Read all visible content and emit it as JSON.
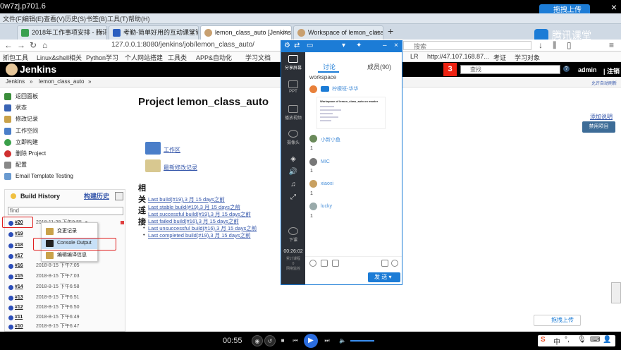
{
  "video": {
    "title": "0w7zj.p701.6",
    "share_label": "拖拽上传",
    "share_bottom_label": "拖拽上传",
    "time": "00:55",
    "brand": "腾讯课堂"
  },
  "browser": {
    "menu": [
      "文件(F)",
      "编辑(E)",
      "查看(V)",
      "历史(S)",
      "书签(B)",
      "工具(T)",
      "帮助(H)"
    ],
    "tabs": [
      {
        "label": "2018年工作事项安排 - 腾讯文档",
        "active": false
      },
      {
        "label": "考勤-简单好用的互动课堂管理",
        "active": false
      },
      {
        "label": "lemon_class_auto [Jenkins]",
        "active": true
      },
      {
        "label": "Workspace of lemon_class_auto",
        "active": false
      }
    ],
    "url": "127.0.0.1:8080/jenkins/job/lemon_class_auto/",
    "search_placeholder": "搜索",
    "bookmarks": [
      "抓包工具",
      "Linux&shell相关",
      "Python学习",
      "个人网站搭建",
      "工具类",
      "APP&自动化",
      "学习文档",
      "LR",
      "http://47.107.168.87...",
      "考证",
      "学习对象"
    ]
  },
  "jenkins": {
    "brand": "Jenkins",
    "badge": "3",
    "search_placeholder": "查找",
    "user": "admin",
    "logout": "| 注销",
    "crumbs": [
      "Jenkins",
      "»",
      "lemon_class_auto",
      "»"
    ],
    "auto_refresh": "允许自动刷新",
    "sidebar": [
      {
        "label": "返回面板",
        "color": "#3a8d3a"
      },
      {
        "label": "状态",
        "color": "#3a64b4"
      },
      {
        "label": "修改记录",
        "color": "#c9a24a"
      },
      {
        "label": "工作空间",
        "color": "#4a7ec9"
      },
      {
        "label": "立即构建",
        "color": "#3aa04a"
      },
      {
        "label": "删除 Project",
        "color": "#d03030"
      },
      {
        "label": "配置",
        "color": "#888888"
      },
      {
        "label": "Email Template Testing",
        "color": "#6a9ad0"
      }
    ],
    "build_history": {
      "title": "Build History",
      "trend": "构建历史",
      "find": "find",
      "rows": [
        {
          "num": "#20",
          "date": "2018-11-28 下午9:55"
        },
        {
          "num": "#19",
          "date": ""
        },
        {
          "num": "#18",
          "date": ""
        },
        {
          "num": "#17",
          "date": ""
        },
        {
          "num": "#16",
          "date": "2018-8-15 下午7:05"
        },
        {
          "num": "#15",
          "date": "2018-8-15 下午7:03"
        },
        {
          "num": "#14",
          "date": "2018-8-15 下午6:58"
        },
        {
          "num": "#13",
          "date": "2018-8-15 下午6:51"
        },
        {
          "num": "#12",
          "date": "2018-8-15 下午6:50"
        },
        {
          "num": "#11",
          "date": "2018-8-15 下午6:49"
        },
        {
          "num": "#10",
          "date": "2018-8-15 下午6:47"
        }
      ]
    },
    "context_menu": [
      {
        "label": "变更记录"
      },
      {
        "label": "Console Output"
      },
      {
        "label": "编辑编译信息"
      }
    ],
    "project_title": "Project lemon_class_auto",
    "add_desc": "添加说明",
    "disable": "禁用项目",
    "workspace_link": "工作区",
    "changes_link": "最新修改记录",
    "related": "相关连接",
    "build_links": [
      "Last build(#19),3 月 15 days之前",
      "Last stable build(#19),3 月 15 days之前",
      "Last successful build(#19),3 月 15 days之前",
      "Last failed build(#16),3 月 15 days之前",
      "Last unsuccessful build(#16),3 月 15 days之前",
      "Last completed build(#19),3 月 15 days之前"
    ]
  },
  "qq": {
    "tab_discuss": "讨论",
    "tab_members": "成员(90)",
    "workspace": "workspace",
    "screenshot_title": "Workspace of lemon_class_auto on master",
    "left": [
      {
        "label": "分享屏幕"
      },
      {
        "label": "PPT"
      },
      {
        "label": "播放视频"
      },
      {
        "label": "摄像头"
      },
      {
        "label": "下课"
      }
    ],
    "timer": "00:26:02",
    "timer_note": "累计课程\n0\n网络监控",
    "messages": [
      {
        "name": "柠檬班-华华",
        "text": ""
      },
      {
        "name": "小新小鱼",
        "text": "1"
      },
      {
        "name": "MIC",
        "text": "1"
      },
      {
        "name": "xiaoxi",
        "text": "1"
      },
      {
        "name": "lucky",
        "text": "1"
      }
    ],
    "send": "发 送"
  }
}
